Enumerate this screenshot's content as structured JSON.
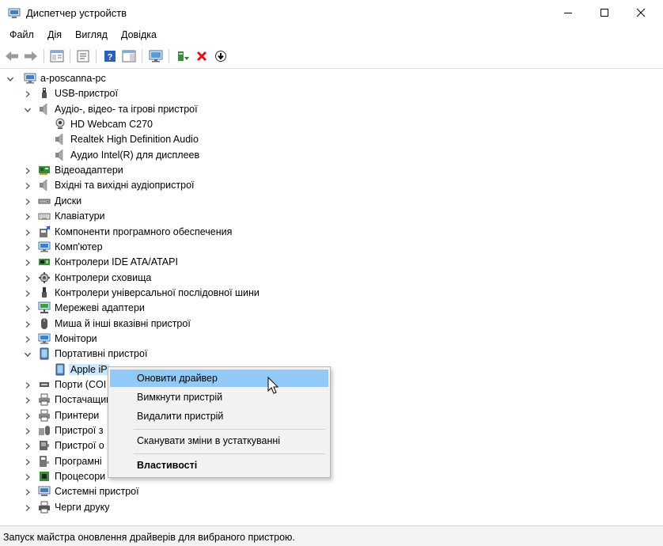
{
  "window": {
    "title": "Диспетчер устройств"
  },
  "menu": [
    "Файл",
    "Дія",
    "Вигляд",
    "Довідка"
  ],
  "toolbar": [
    {
      "name": "back-icon"
    },
    {
      "name": "forward-icon"
    },
    {
      "name": "show-hide-tree-icon"
    },
    {
      "name": "properties-icon"
    },
    {
      "name": "help-icon"
    },
    {
      "name": "action-pane-icon"
    },
    {
      "name": "monitor-icon"
    },
    {
      "name": "update-driver-icon"
    },
    {
      "name": "uninstall-icon"
    },
    {
      "name": "download-icon"
    }
  ],
  "tree": [
    {
      "level": 0,
      "state": "expanded",
      "icon": "computer-icon",
      "label": "a-poscanna-pc"
    },
    {
      "level": 1,
      "state": "collapsed",
      "icon": "usb-icon",
      "label": "USB-пристрої"
    },
    {
      "level": 1,
      "state": "expanded",
      "icon": "speaker-icon",
      "label": "Аудіо-, відео- та ігрові пристрої"
    },
    {
      "level": 2,
      "state": "none",
      "icon": "webcam-icon",
      "label": "HD Webcam C270"
    },
    {
      "level": 2,
      "state": "none",
      "icon": "speaker-icon",
      "label": "Realtek High Definition Audio"
    },
    {
      "level": 2,
      "state": "none",
      "icon": "speaker-icon",
      "label": "Аудио Intel(R) для дисплеев"
    },
    {
      "level": 1,
      "state": "collapsed",
      "icon": "display-adapter-icon",
      "label": "Відеоадаптери"
    },
    {
      "level": 1,
      "state": "collapsed",
      "icon": "speaker-icon",
      "label": "Вхідні та вихідні аудіопристрої"
    },
    {
      "level": 1,
      "state": "collapsed",
      "icon": "disk-icon",
      "label": "Диски"
    },
    {
      "level": 1,
      "state": "collapsed",
      "icon": "keyboard-icon",
      "label": "Клавіатури"
    },
    {
      "level": 1,
      "state": "collapsed",
      "icon": "software-component-icon",
      "label": "Компоненти програмного обеспечения"
    },
    {
      "level": 1,
      "state": "collapsed",
      "icon": "computer-icon",
      "label": "Комп'ютер"
    },
    {
      "level": 1,
      "state": "collapsed",
      "icon": "ide-controller-icon",
      "label": "Контролери IDE ATA/ATAPI"
    },
    {
      "level": 1,
      "state": "collapsed",
      "icon": "storage-controller-icon",
      "label": "Контролери сховища"
    },
    {
      "level": 1,
      "state": "collapsed",
      "icon": "usb-controller-icon",
      "label": "Контролери універсальної послідовної шини"
    },
    {
      "level": 1,
      "state": "collapsed",
      "icon": "network-adapter-icon",
      "label": "Мережеві адаптери"
    },
    {
      "level": 1,
      "state": "collapsed",
      "icon": "mouse-icon",
      "label": "Миша й інші вказівні пристрої"
    },
    {
      "level": 1,
      "state": "collapsed",
      "icon": "monitor-icon",
      "label": "Монітори"
    },
    {
      "level": 1,
      "state": "expanded",
      "icon": "portable-device-icon",
      "label": "Портативні пристрої"
    },
    {
      "level": 2,
      "state": "none",
      "icon": "portable-device-icon",
      "label": "Apple iP",
      "selected": true
    },
    {
      "level": 1,
      "state": "collapsed",
      "icon": "port-icon",
      "label": "Порти (COI"
    },
    {
      "level": 1,
      "state": "collapsed",
      "icon": "printer-icon",
      "label": "Постачащик"
    },
    {
      "level": 1,
      "state": "collapsed",
      "icon": "printer-icon",
      "label": "Принтери"
    },
    {
      "level": 1,
      "state": "collapsed",
      "icon": "hid-icon",
      "label": "Пристрої з"
    },
    {
      "level": 1,
      "state": "collapsed",
      "icon": "device-icon",
      "label": "Пристрої о"
    },
    {
      "level": 1,
      "state": "collapsed",
      "icon": "software-device-icon",
      "label": "Програмні"
    },
    {
      "level": 1,
      "state": "collapsed",
      "icon": "processor-icon",
      "label": "Процесори"
    },
    {
      "level": 1,
      "state": "collapsed",
      "icon": "system-device-icon",
      "label": "Системні пристрої"
    },
    {
      "level": 1,
      "state": "collapsed",
      "icon": "print-queue-icon",
      "label": "Черги друку"
    }
  ],
  "context_menu": {
    "update_driver": "Оновити драйвер",
    "disable_device": "Вимкнути пристрій",
    "uninstall_device": "Видалити пристрій",
    "scan_changes": "Сканувати зміни в устаткуванні",
    "properties": "Властивості"
  },
  "status": "Запуск майстра оновлення драйверів для вибраного пристрою.",
  "colors": {
    "menu_highlight": "#91c9f7",
    "selection": "#cce8ff",
    "delete_red": "#e81123",
    "help_blue": "#2b5ebd"
  }
}
